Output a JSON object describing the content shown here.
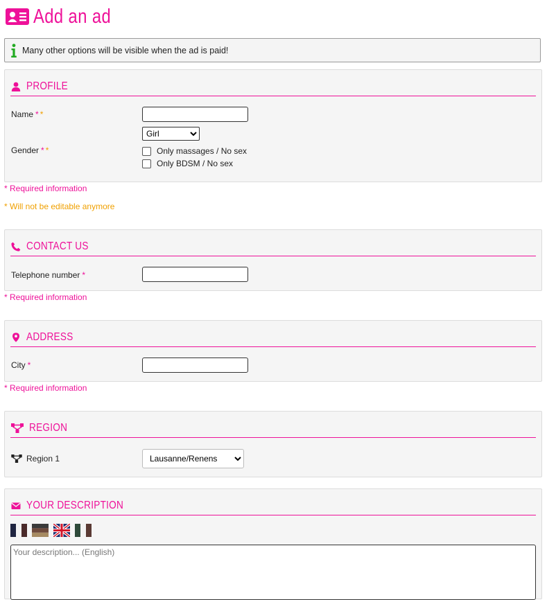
{
  "page": {
    "title": "Add an ad"
  },
  "notice": {
    "text": "Many other options will be visible when the ad is paid!"
  },
  "profile": {
    "title": "PROFILE",
    "name_label": "Name",
    "gender_label": "Gender",
    "req_mark": "*",
    "name_value": "",
    "gender_selected": "Girl",
    "options": [
      "Only massages / No sex",
      "Only BDSM / No sex"
    ]
  },
  "notes": {
    "required": "* Required information",
    "not_editable": "* Will not be editable anymore"
  },
  "contact": {
    "title": "CONTACT US",
    "phone_label": "Telephone number",
    "phone_value": ""
  },
  "address": {
    "title": "ADDRESS",
    "city_label": "City",
    "city_value": ""
  },
  "region": {
    "title": "REGION",
    "region_label": "Region 1",
    "region_selected": "Lausanne/Renens"
  },
  "description": {
    "title": "YOUR DESCRIPTION",
    "placeholder": "Your description... (English)",
    "languages": [
      "french-flag",
      "german-flag",
      "english-flag",
      "italian-flag"
    ]
  },
  "colors": {
    "accent": "#ee1199",
    "orange": "#f0a000",
    "panel_bg": "#f5f5f5",
    "info_green": "#22aa22"
  }
}
